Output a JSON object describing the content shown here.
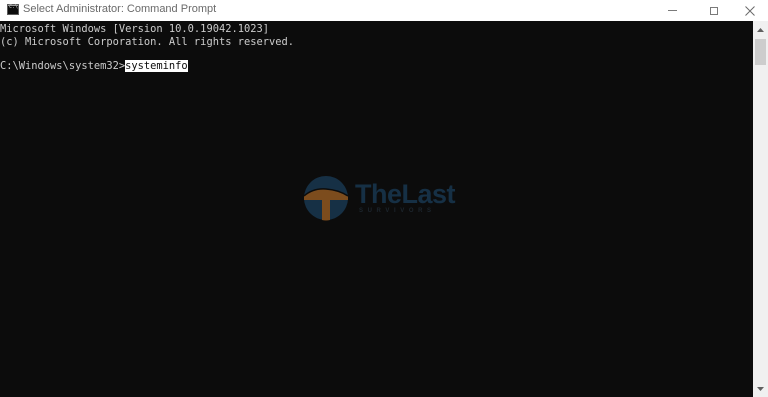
{
  "window": {
    "title": "Select Administrator: Command Prompt"
  },
  "console": {
    "line1": "Microsoft Windows [Version 10.0.19042.1023]",
    "line2": "(c) Microsoft Corporation. All rights reserved.",
    "prompt": "C:\\Windows\\system32>",
    "command": "systeminfo"
  },
  "watermark": {
    "brand": "TheLast",
    "tagline": "SURVIVORS"
  },
  "icons": {
    "app": "command-prompt-icon",
    "minimize": "minimize-icon",
    "maximize": "maximize-icon",
    "close": "close-icon",
    "scroll_up": "chevron-up-icon",
    "scroll_down": "chevron-down-icon"
  },
  "colors": {
    "console_bg": "#0c0c0c",
    "console_text": "#cccccc",
    "selection_bg": "#ffffff",
    "watermark_blue": "#1f4e74",
    "watermark_orange": "#d9822b"
  }
}
